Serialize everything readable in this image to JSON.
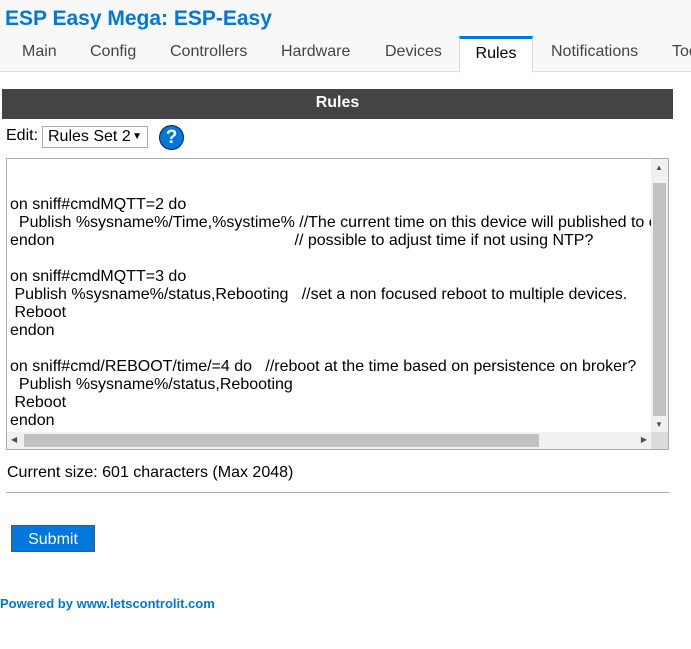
{
  "header": {
    "title": "ESP Easy Mega: ESP-Easy"
  },
  "tabs": [
    "Main",
    "Config",
    "Controllers",
    "Hardware",
    "Devices",
    "Rules",
    "Notifications",
    "Tools"
  ],
  "active_tab": "Rules",
  "section": {
    "title": "Rules"
  },
  "edit": {
    "label": "Edit:",
    "selected": "Rules Set 2",
    "help_icon": "?"
  },
  "rules_text": "\n\non sniff#cmdMQTT=2 do\n  Publish %sysname%/Time,%systime% //The current time on this device will published to other devices.\nendon                                                      // possible to adjust time if not using NTP?\n\non sniff#cmdMQTT=3 do\n Publish %sysname%/status,Rebooting   //set a non focused reboot to multiple devices.\n Reboot\nendon\n\non sniff#cmd/REBOOT/time/=4 do   //reboot at the time based on persistence on broker?\n  Publish %sysname%/status,Rebooting\n Reboot\nendon",
  "size_text": "Current size: 601 characters (Max 2048)",
  "submit_label": "Submit",
  "footer": "Powered by www.letscontrolit.com",
  "colors": {
    "accent": "#0077dd",
    "bar": "#444444"
  }
}
